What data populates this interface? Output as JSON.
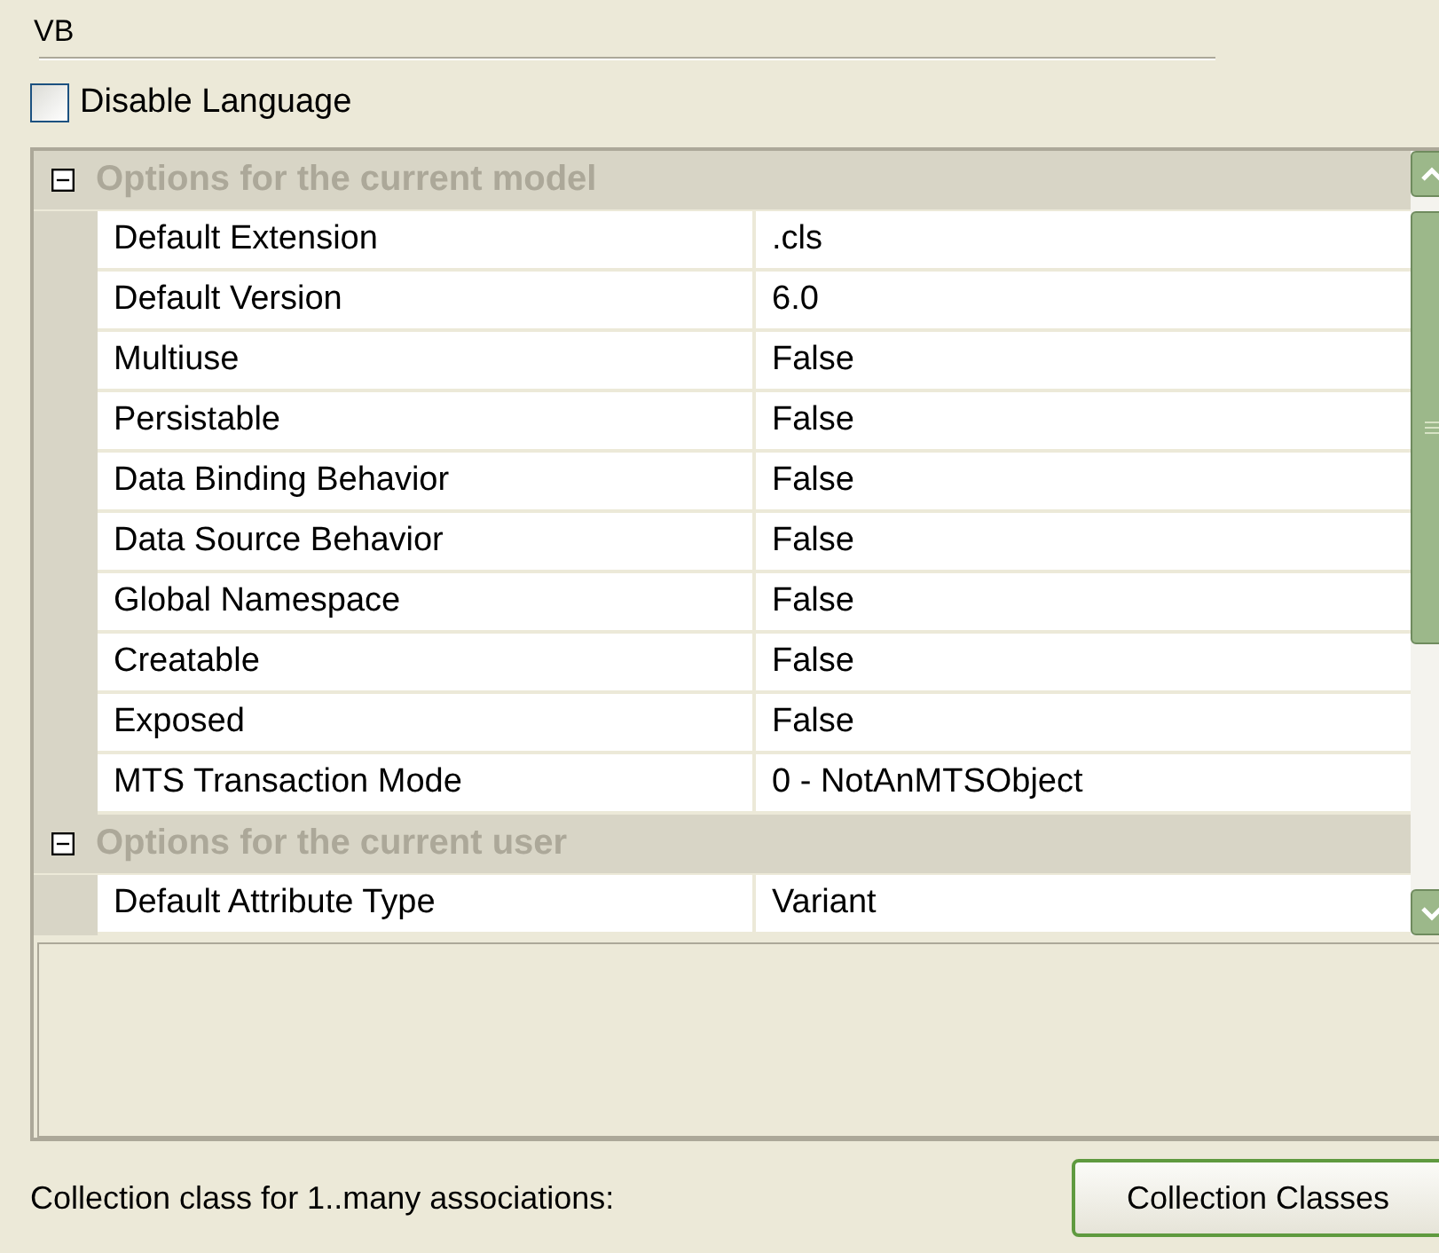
{
  "group_title": "VB",
  "disable_language": {
    "label": "Disable Language",
    "checked": false
  },
  "property_grid": {
    "categories": [
      {
        "title": "Options for the current model",
        "expanded": true,
        "properties": [
          {
            "name": "Default Extension",
            "value": ".cls"
          },
          {
            "name": "Default Version",
            "value": "6.0"
          },
          {
            "name": "Multiuse",
            "value": "False"
          },
          {
            "name": "Persistable",
            "value": "False"
          },
          {
            "name": "Data Binding Behavior",
            "value": "False"
          },
          {
            "name": "Data Source Behavior",
            "value": "False"
          },
          {
            "name": "Global Namespace",
            "value": "False"
          },
          {
            "name": "Creatable",
            "value": "False"
          },
          {
            "name": "Exposed",
            "value": "False"
          },
          {
            "name": "MTS Transaction Mode",
            "value": "0 - NotAnMTSObject"
          }
        ]
      },
      {
        "title": "Options for the current user",
        "expanded": true,
        "properties": [
          {
            "name": "Default Attribute Type",
            "value": "Variant"
          }
        ]
      }
    ]
  },
  "collection_label": "Collection class for 1..many associations:",
  "collection_button": "Collection Classes"
}
